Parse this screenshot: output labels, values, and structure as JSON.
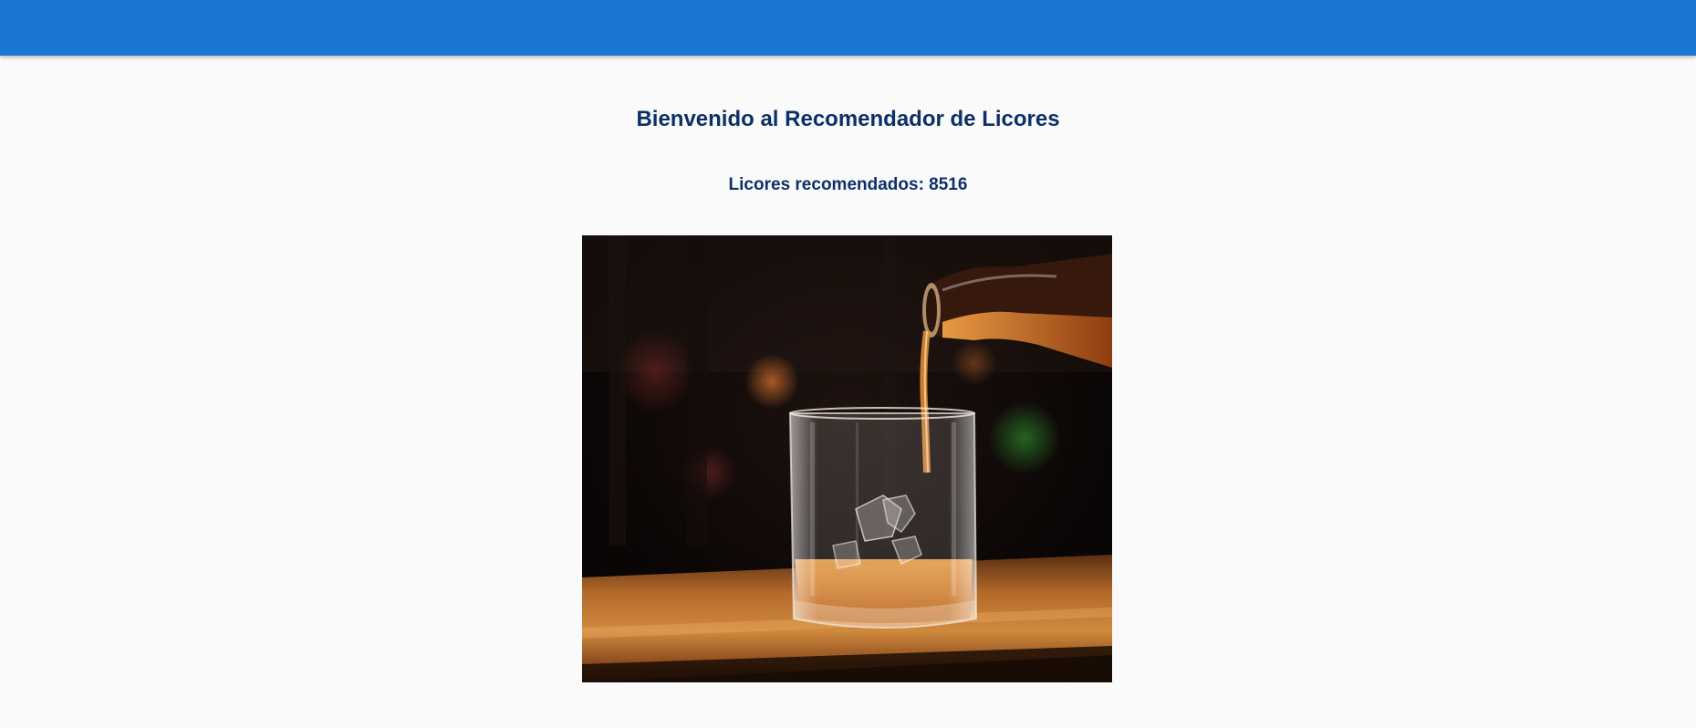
{
  "header": {
    "color": "#1976d2"
  },
  "main": {
    "title": "Bienvenido al Recomendador de Licores",
    "subtitle": "Licores recomendados: 8516",
    "text_color": "#0d3068"
  },
  "image": {
    "alt": "Whisky siendo servido en un vaso con hielo"
  }
}
